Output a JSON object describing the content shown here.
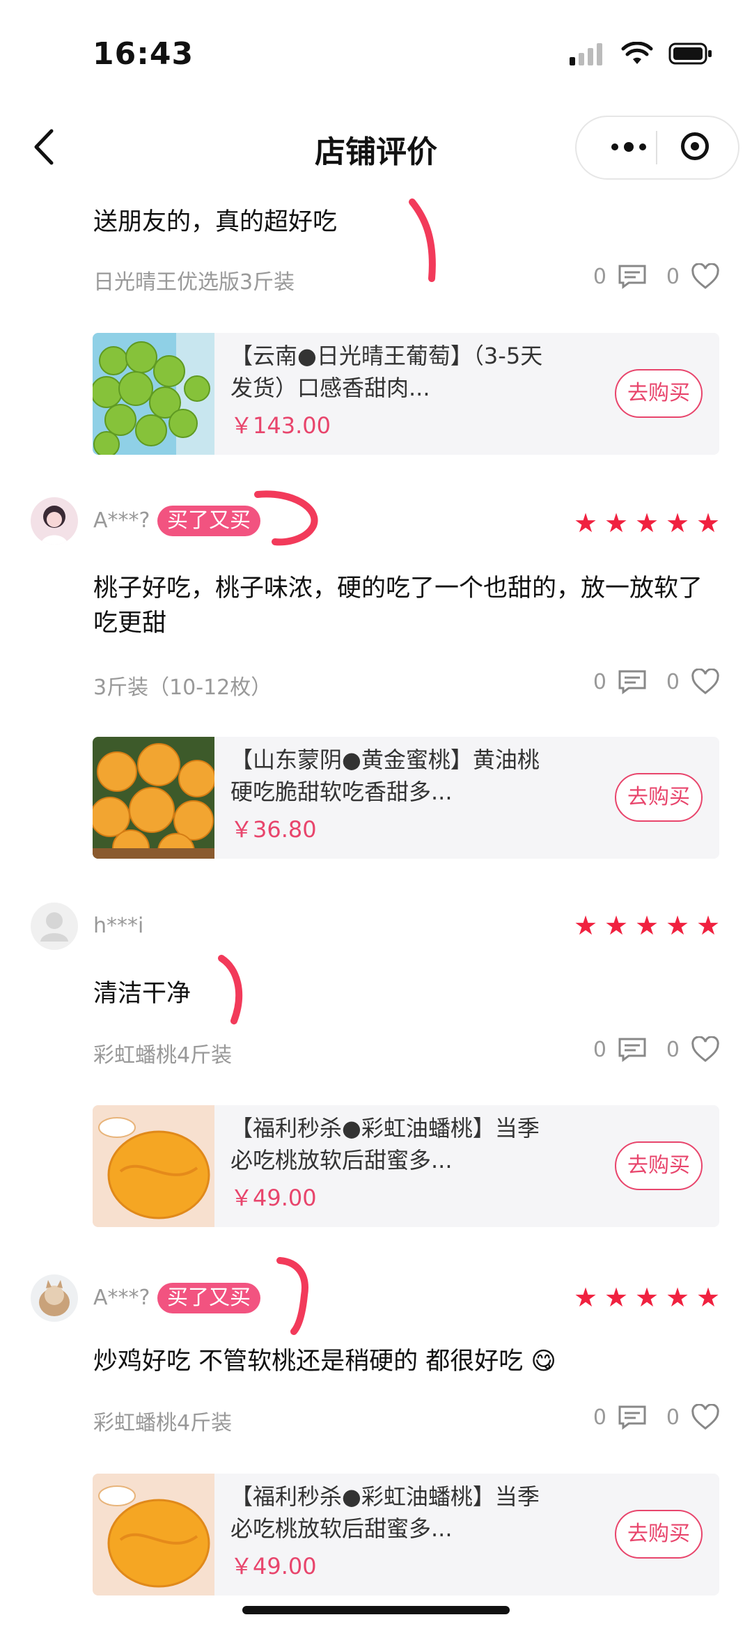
{
  "status_bar": {
    "time": "16:43"
  },
  "nav": {
    "title": "店铺评价"
  },
  "colors": {
    "accent": "#f25380",
    "star": "#f0213f",
    "price": "#e8456c"
  },
  "reviews": [
    {
      "content": "送朋友的，真的超好吃",
      "spec": "日光晴王优选版3斤装",
      "comments": "0",
      "likes": "0",
      "product": {
        "title": "【云南●日光晴王葡萄】（3-5天发货）口感香甜肉...",
        "price": "￥143.00",
        "buy": "去购买"
      }
    },
    {
      "user": "A***?",
      "badge": "买了又买",
      "rating": 5,
      "content": "桃子好吃，桃子味浓，硬的吃了一个也甜的，放一放软了吃更甜",
      "spec": "3斤装（10-12枚）",
      "comments": "0",
      "likes": "0",
      "product": {
        "title": "【山东蒙阴●黄金蜜桃】黄油桃硬吃脆甜软吃香甜多...",
        "price": "￥36.80",
        "buy": "去购买"
      }
    },
    {
      "user": "h***i",
      "rating": 5,
      "content": "清洁干净",
      "spec": "彩虹蟠桃4斤装",
      "comments": "0",
      "likes": "0",
      "product": {
        "title": "【福利秒杀●彩虹油蟠桃】当季必吃桃放软后甜蜜多...",
        "price": "￥49.00",
        "buy": "去购买"
      }
    },
    {
      "user": "A***?",
      "badge": "买了又买",
      "rating": 5,
      "content": "炒鸡好吃 不管软桃还是稍硬的 都很好吃 😋",
      "spec": "彩虹蟠桃4斤装",
      "comments": "0",
      "likes": "0",
      "product": {
        "title": "【福利秒杀●彩虹油蟠桃】当季必吃桃放软后甜蜜多...",
        "price": "￥49.00",
        "buy": "去购买"
      }
    }
  ]
}
